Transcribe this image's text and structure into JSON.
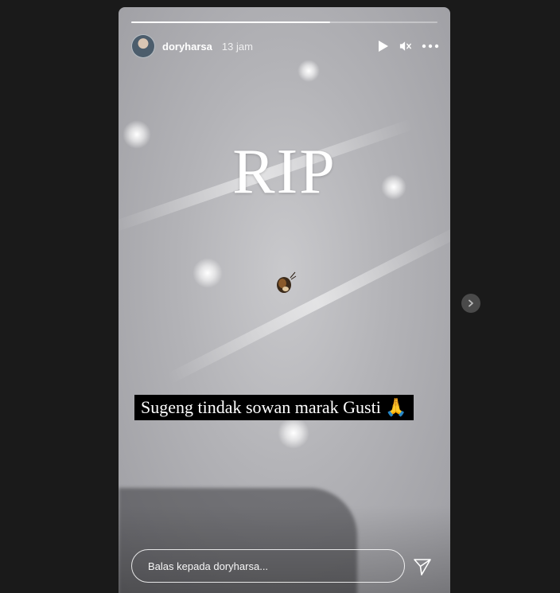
{
  "story": {
    "progress": 0.65,
    "username": "doryharsa",
    "time": "13 jam",
    "title_text": "RIP",
    "caption": "Sugeng tindak sowan marak Gusti 🙏",
    "reply_placeholder": "Balas kepada doryharsa..."
  },
  "icons": {
    "avatar": "avatar-image",
    "play": "play-icon",
    "mute": "speaker-muted-icon",
    "more": "more-horizontal-icon",
    "send": "paper-plane-icon",
    "next": "chevron-right-icon"
  },
  "colors": {
    "page_bg": "#1a1a1a",
    "text": "#ffffff",
    "caption_bg": "#000000",
    "next_button_bg": "#4a4a4a"
  }
}
